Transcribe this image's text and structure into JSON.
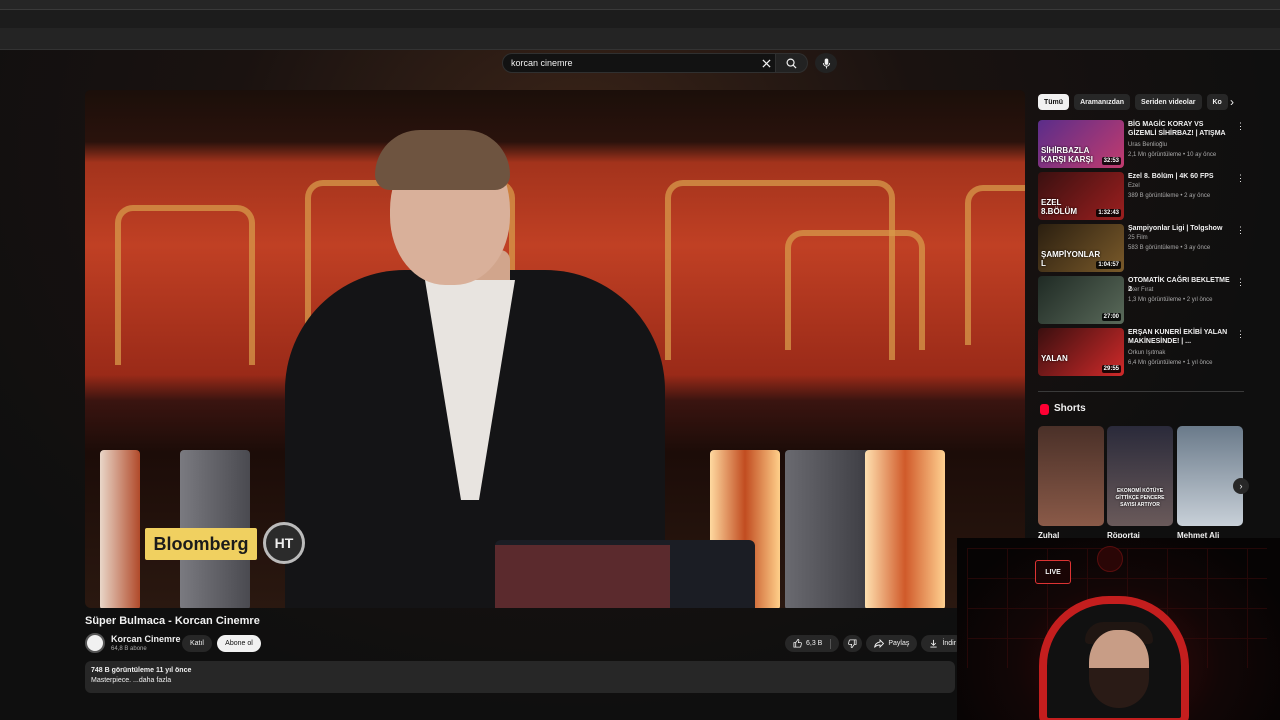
{
  "search": {
    "value": "korcan cinemre"
  },
  "video": {
    "overlay_brand": "Bloomberg",
    "overlay_logo": "HT",
    "title": "Süper Bulmaca - Korcan Cinemre",
    "channel": "Korcan Cinemre",
    "subscribers": "64,8 B abone",
    "join_label": "Katıl",
    "subscribe_label": "Abone ol",
    "likes": "6,3 B",
    "share_label": "Paylaş",
    "download_label": "İndir",
    "views_line": "748 B görüntüleme  11 yıl önce",
    "description": "Masterpiece. ...daha fazla"
  },
  "chips": [
    "Tümü",
    "Aramanızdan",
    "Seriden videolar",
    "Ko"
  ],
  "recommended": [
    {
      "title": "BİG MAGİC KORAY VS GİZEMLİ SİHİRBAZ! | ATIŞMA",
      "channel": "Uras Benlioğlu",
      "meta": "2,1 Mn görüntüleme • 10 ay önce",
      "duration": "32:53",
      "thumb_text": "SİHİRBAZLA KARŞI KARŞI",
      "c1": "#5a2d8a",
      "c2": "#c23b6e"
    },
    {
      "title": "Ezel 8. Bölüm | 4K 60 FPS",
      "channel": "Ezel",
      "meta": "389 B görüntüleme • 2 ay önce",
      "duration": "1:32:43",
      "thumb_text": "EZEL 8.BÖLÜM",
      "c1": "#3a1010",
      "c2": "#9c1f1f"
    },
    {
      "title": "Şampiyonlar Ligi | Tolgshow",
      "channel": "25 Film",
      "meta": "583 B görüntüleme • 3 ay önce",
      "duration": "1:04:57",
      "thumb_text": "ŞAMPİYONLAR L",
      "c1": "#2b1f10",
      "c2": "#7a5a2a"
    },
    {
      "title": "OTOMATİK CAĞRI BEKLETME 2",
      "channel": "İlker Fırat",
      "meta": "1,3 Mn görüntüleme • 2 yıl önce",
      "duration": "27:00",
      "thumb_text": "",
      "c1": "#1f2a24",
      "c2": "#5a6a5a"
    },
    {
      "title": "ERŞAN KUNERİ EKİBİ YALAN MAKİNESİNDE! | ...",
      "channel": "Orkun Işıtmak",
      "meta": "6,4 Mn görüntüleme • 1 yıl önce",
      "duration": "29:55",
      "thumb_text": "YALAN",
      "c1": "#3a0f0f",
      "c2": "#d12a2a"
    }
  ],
  "shorts": {
    "title": "Shorts",
    "items": [
      {
        "label": "Zuhal",
        "text": "",
        "c1": "#4a3028",
        "c2": "#8a5a48"
      },
      {
        "label": "Röportaj",
        "text": "EKONOMİ KÖTÜYE GİTTİKÇE PENCERE SAYISI ARTIYOR",
        "c1": "#2a2a3a",
        "c2": "#6a5a5a"
      },
      {
        "label": "Mehmet Ali",
        "text": "",
        "c1": "#6a7a8a",
        "c2": "#c8d0d8"
      }
    ]
  },
  "webcam": {
    "live_label": "LIVE"
  }
}
